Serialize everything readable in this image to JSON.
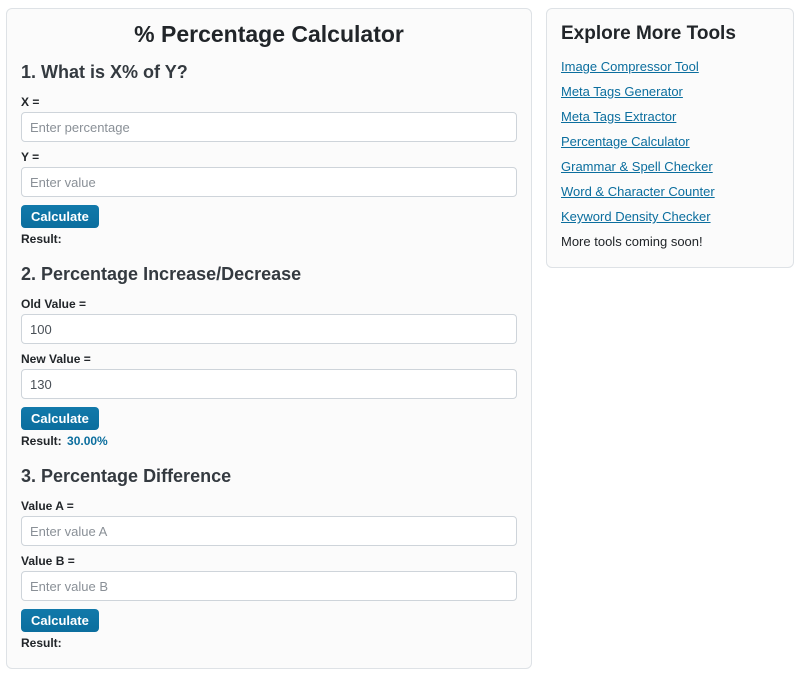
{
  "page_title": "% Percentage Calculator",
  "section1": {
    "heading": "1. What is X% of Y?",
    "x_label": "X =",
    "x_placeholder": "Enter percentage",
    "x_value": "",
    "y_label": "Y =",
    "y_placeholder": "Enter value",
    "y_value": "",
    "button": "Calculate",
    "result_label": "Result:",
    "result_value": ""
  },
  "section2": {
    "heading": "2. Percentage Increase/Decrease",
    "old_label": "Old Value =",
    "old_value": "100",
    "new_label": "New Value =",
    "new_value": "130",
    "button": "Calculate",
    "result_label": "Result:",
    "result_value": "30.00%"
  },
  "section3": {
    "heading": "3. Percentage Difference",
    "a_label": "Value A =",
    "a_placeholder": "Enter value A",
    "a_value": "",
    "b_label": "Value B =",
    "b_placeholder": "Enter value B",
    "b_value": "",
    "button": "Calculate",
    "result_label": "Result:",
    "result_value": ""
  },
  "sidebar": {
    "heading": "Explore More Tools",
    "links": [
      "Image Compressor Tool",
      "Meta Tags Generator",
      "Meta Tags Extractor",
      "Percentage Calculator",
      "Grammar & Spell Checker",
      "Word & Character Counter",
      "Keyword Density Checker"
    ],
    "more_text": "More tools coming soon!"
  }
}
